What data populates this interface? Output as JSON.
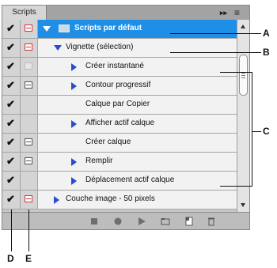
{
  "panel": {
    "tab_label": "Scripts",
    "menu_glyph": "▸▸",
    "menu_lines": "≡"
  },
  "rows": [
    {
      "label": "Scripts par défaut",
      "check": "✔",
      "dialog": "red",
      "kind": "set",
      "selected": true
    },
    {
      "label": "Vignette (sélection)",
      "check": "✔",
      "dialog": "red",
      "kind": "action-open"
    },
    {
      "label": "Créer instantané",
      "check": "✔",
      "dialog": "empty",
      "kind": "command-closed"
    },
    {
      "label": "Contour progressif",
      "check": "✔",
      "dialog": "normal",
      "kind": "command-closed"
    },
    {
      "label": "Calque par Copier",
      "check": "✔",
      "dialog": "none",
      "kind": "command-plain"
    },
    {
      "label": "Afficher actif calque",
      "check": "✔",
      "dialog": "none",
      "kind": "command-closed"
    },
    {
      "label": "Créer calque",
      "check": "✔",
      "dialog": "normal",
      "kind": "command-plain"
    },
    {
      "label": "Remplir",
      "check": "✔",
      "dialog": "normal",
      "kind": "command-closed"
    },
    {
      "label": "Déplacement actif calque",
      "check": "✔",
      "dialog": "none",
      "kind": "command-closed"
    },
    {
      "label": "Couche image - 50 pixels",
      "check": "✔",
      "dialog": "red",
      "kind": "action-closed"
    }
  ],
  "toolbar": {
    "icons": [
      "stop-icon",
      "record-icon",
      "play-icon",
      "new-set-folder-icon",
      "new-action-icon",
      "trash-icon"
    ]
  },
  "callouts": {
    "a": "A",
    "b": "B",
    "c": "C",
    "d": "D",
    "e": "E"
  }
}
